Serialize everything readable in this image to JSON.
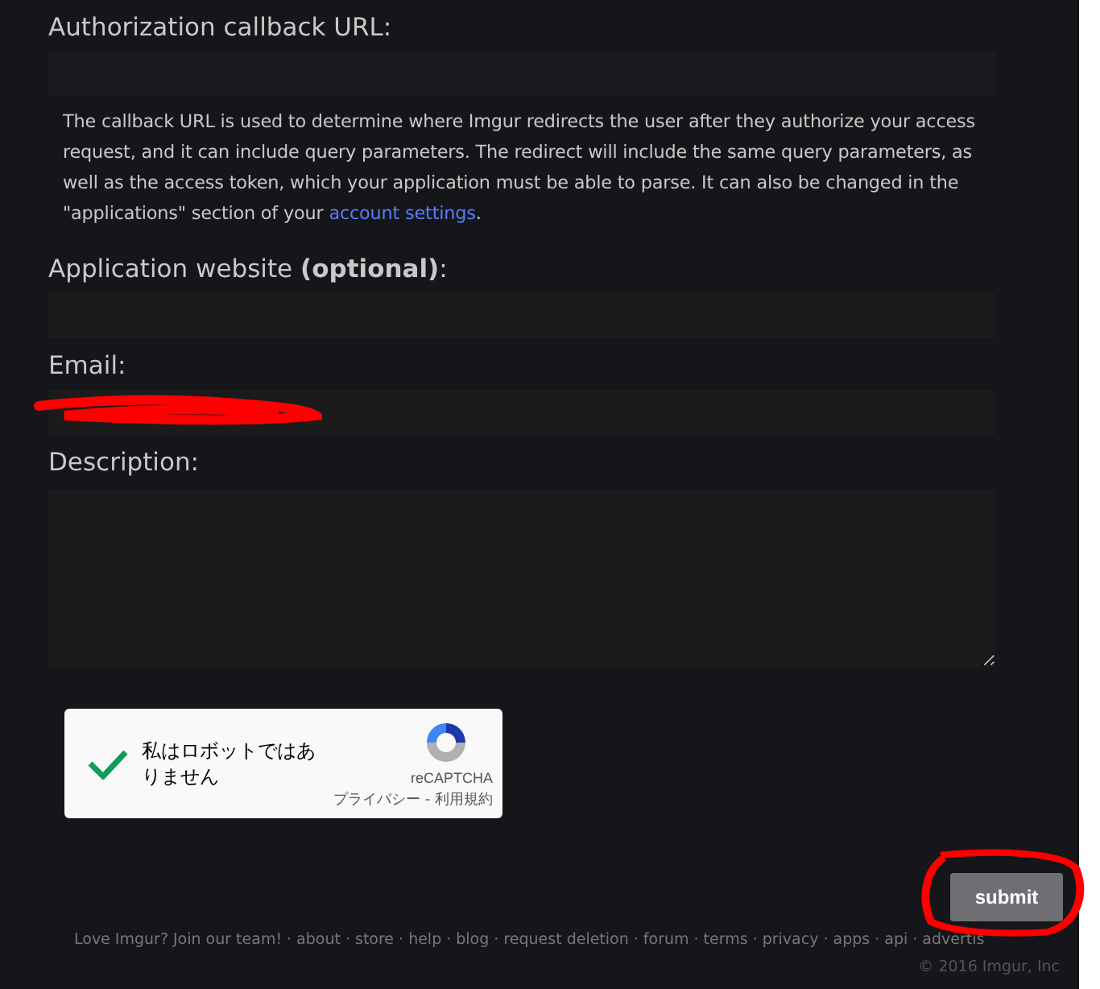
{
  "fields": [
    {
      "kind": "input",
      "label": "Authorization callback URL:",
      "help": "The callback URL is used to determine where Imgur redirects the user after they authorize your access request, and it can include query parameters. The redirect will include the same query parameters, as well as the access token, which your application must be able to parse. It can also be changed in the \"applications\" section of your",
      "help_link": "account settings",
      "help_end": "."
    },
    {
      "kind": "input",
      "label": "Application website **(optional)**:"
    },
    {
      "kind": "input",
      "label": "Email:",
      "redacted": true
    },
    {
      "kind": "textarea",
      "label": "Description:"
    }
  ],
  "captcha": {
    "checked": true,
    "text": "私はロボットではありません",
    "brand": "reCAPTCHA",
    "terms": "プライバシー - 利用規約"
  },
  "submit": {
    "label": "submit",
    "circled": true
  },
  "footer": {
    "separator": "·",
    "links": [
      "Love Imgur? Join our team!",
      "about",
      "store",
      "help",
      "blog",
      "request deletion",
      "forum",
      "terms",
      "privacy",
      "apps",
      "api",
      "advertis"
    ],
    "copyright": "© 2016 Imgur, Inc"
  }
}
